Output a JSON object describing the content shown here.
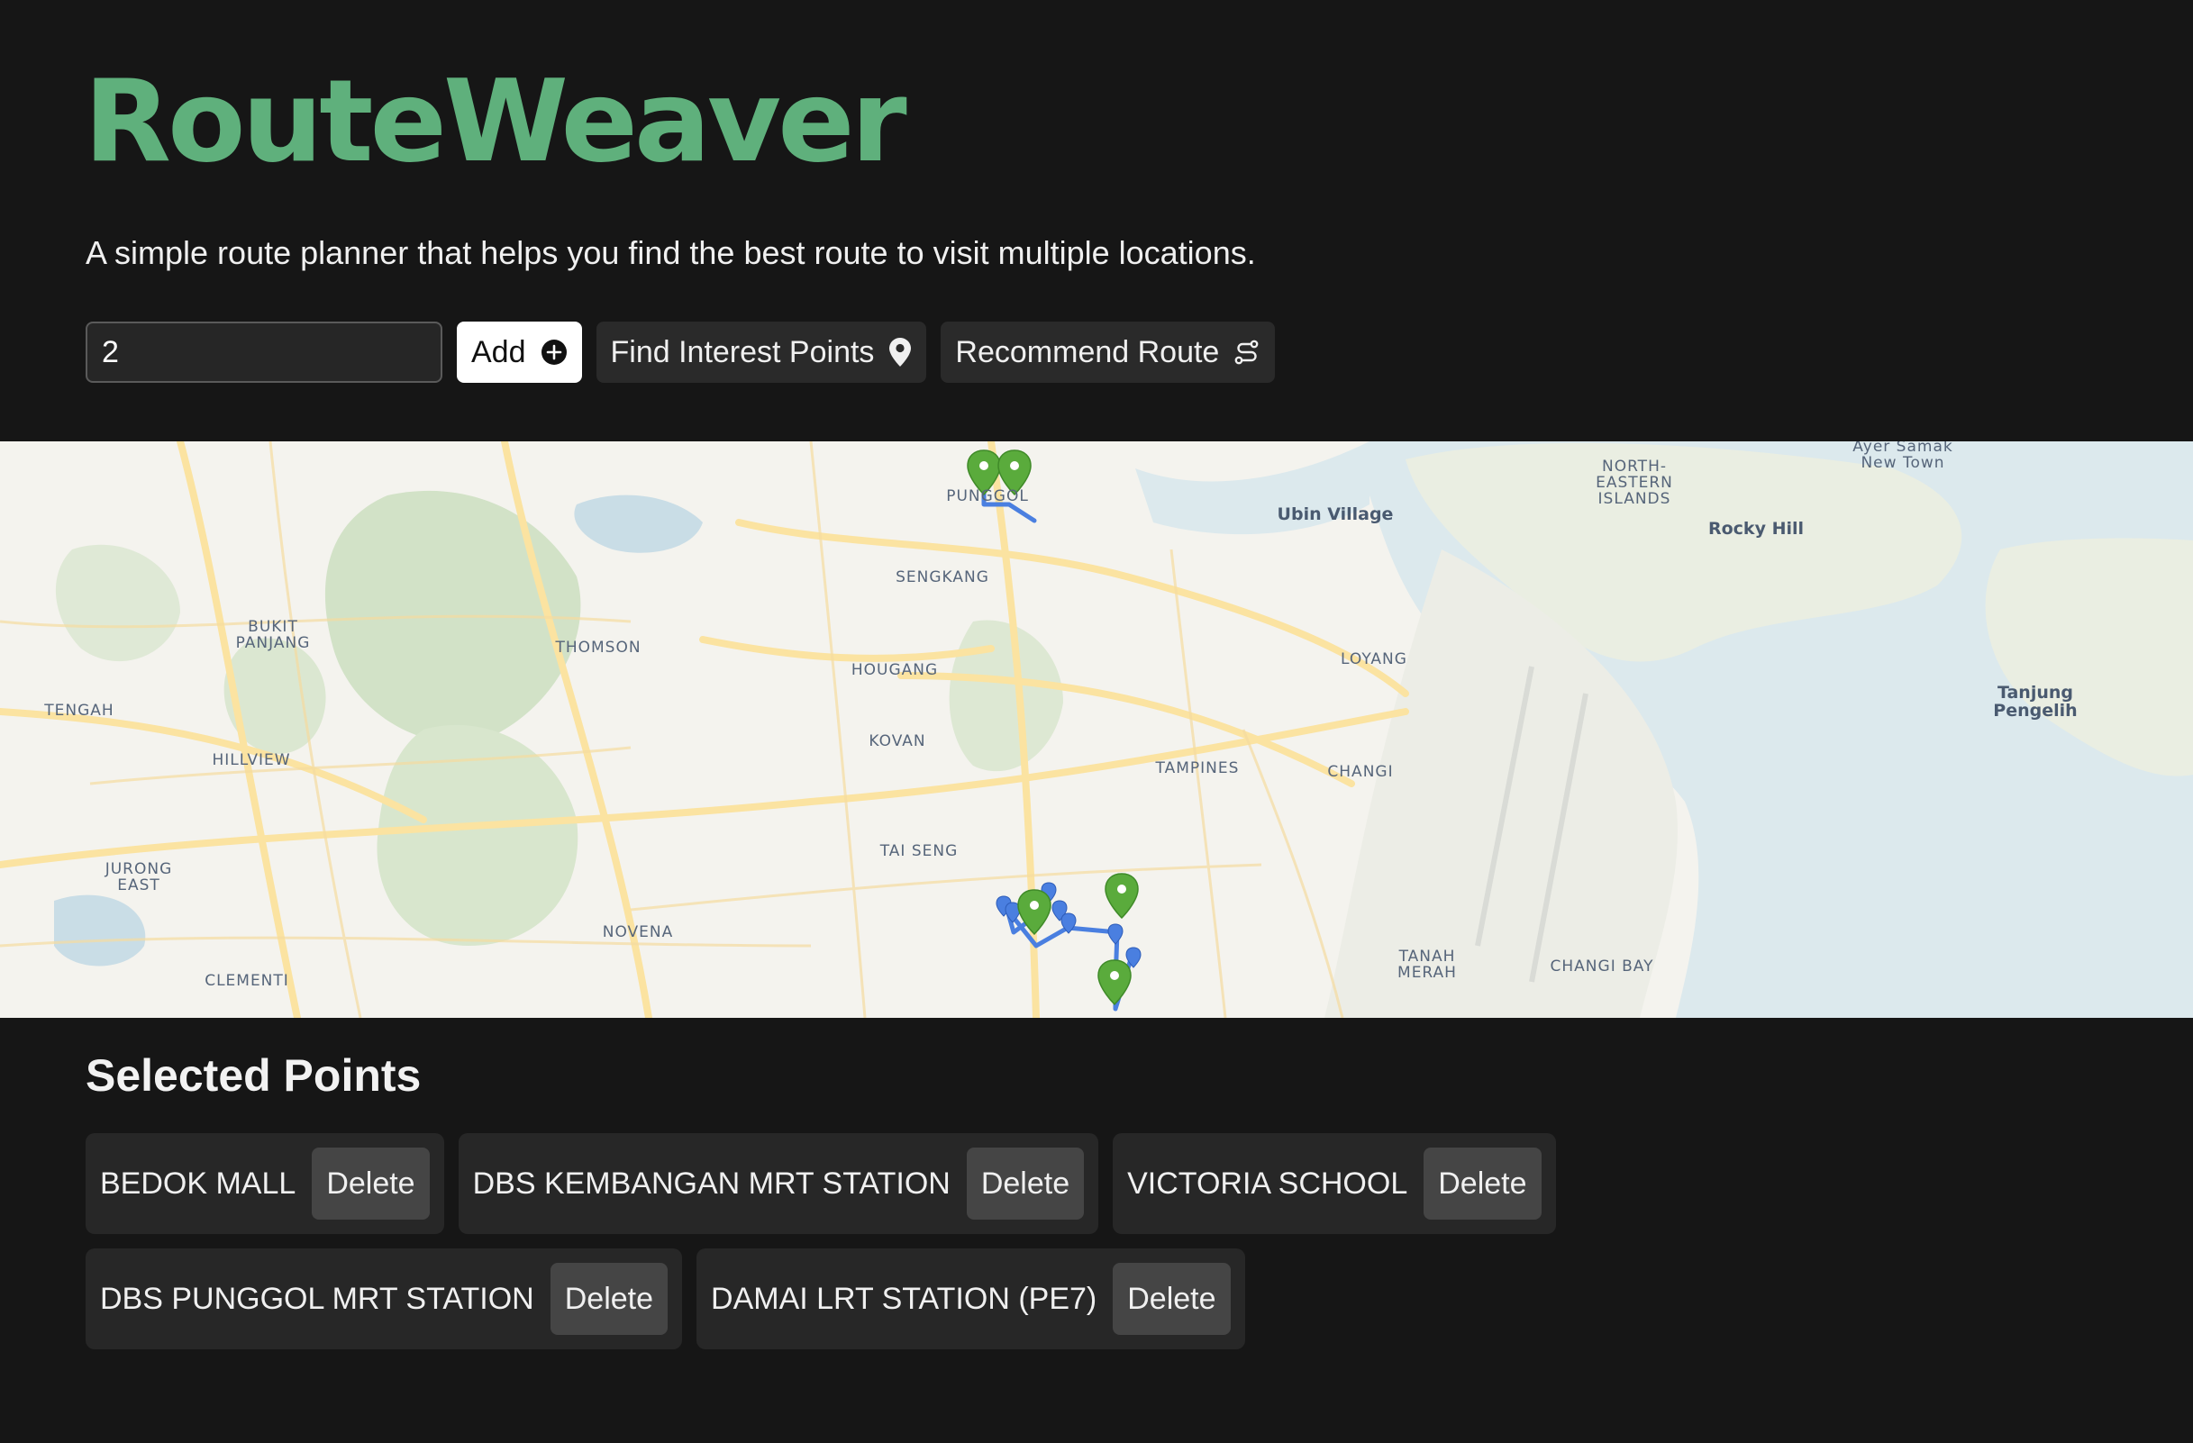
{
  "app": {
    "title": "RouteWeaver",
    "title_color": "#5fb07c",
    "tagline": "A simple route planner that helps you find the best route to visit multiple locations."
  },
  "controls": {
    "input_value": "2",
    "add_label": "Add",
    "add_icon": "plus-circle-icon",
    "find_label": "Find Interest Points",
    "find_icon": "map-pin-icon",
    "recommend_label": "Recommend Route",
    "recommend_icon": "route-icon"
  },
  "map": {
    "labels": [
      {
        "text": "PUNGGOL"
      },
      {
        "text": "SENGKANG"
      },
      {
        "text": "Ubin Village"
      },
      {
        "text": "NORTH-\nEASTERN\nISLANDS"
      },
      {
        "text": "Ayer Samak\nNew Town"
      },
      {
        "text": "Rocky Hill"
      },
      {
        "text": "BUKIT\nPANJANG"
      },
      {
        "text": "THOMSON"
      },
      {
        "text": "HOUGANG"
      },
      {
        "text": "LOYANG"
      },
      {
        "text": "TENGAH"
      },
      {
        "text": "KOVAN"
      },
      {
        "text": "Tanjung\nPengelih"
      },
      {
        "text": "HILLVIEW"
      },
      {
        "text": "TAMPINES"
      },
      {
        "text": "CHANGI"
      },
      {
        "text": "TAI SENG"
      },
      {
        "text": "JURONG\nEAST"
      },
      {
        "text": "NOVENA"
      },
      {
        "text": "TANAH\nMERAH"
      },
      {
        "text": "CHANGI BAY"
      },
      {
        "text": "CLEMENTI"
      }
    ],
    "route_color": "#4a7fe0",
    "selected_marker_color": "#5aab3c",
    "interest_marker_color": "#4a7fe0"
  },
  "selected": {
    "heading": "Selected Points",
    "delete_label": "Delete",
    "points": [
      "BEDOK MALL",
      "DBS KEMBANGAN MRT STATION",
      "VICTORIA SCHOOL",
      "DBS PUNGGOL MRT STATION",
      "DAMAI LRT STATION (PE7)"
    ]
  }
}
